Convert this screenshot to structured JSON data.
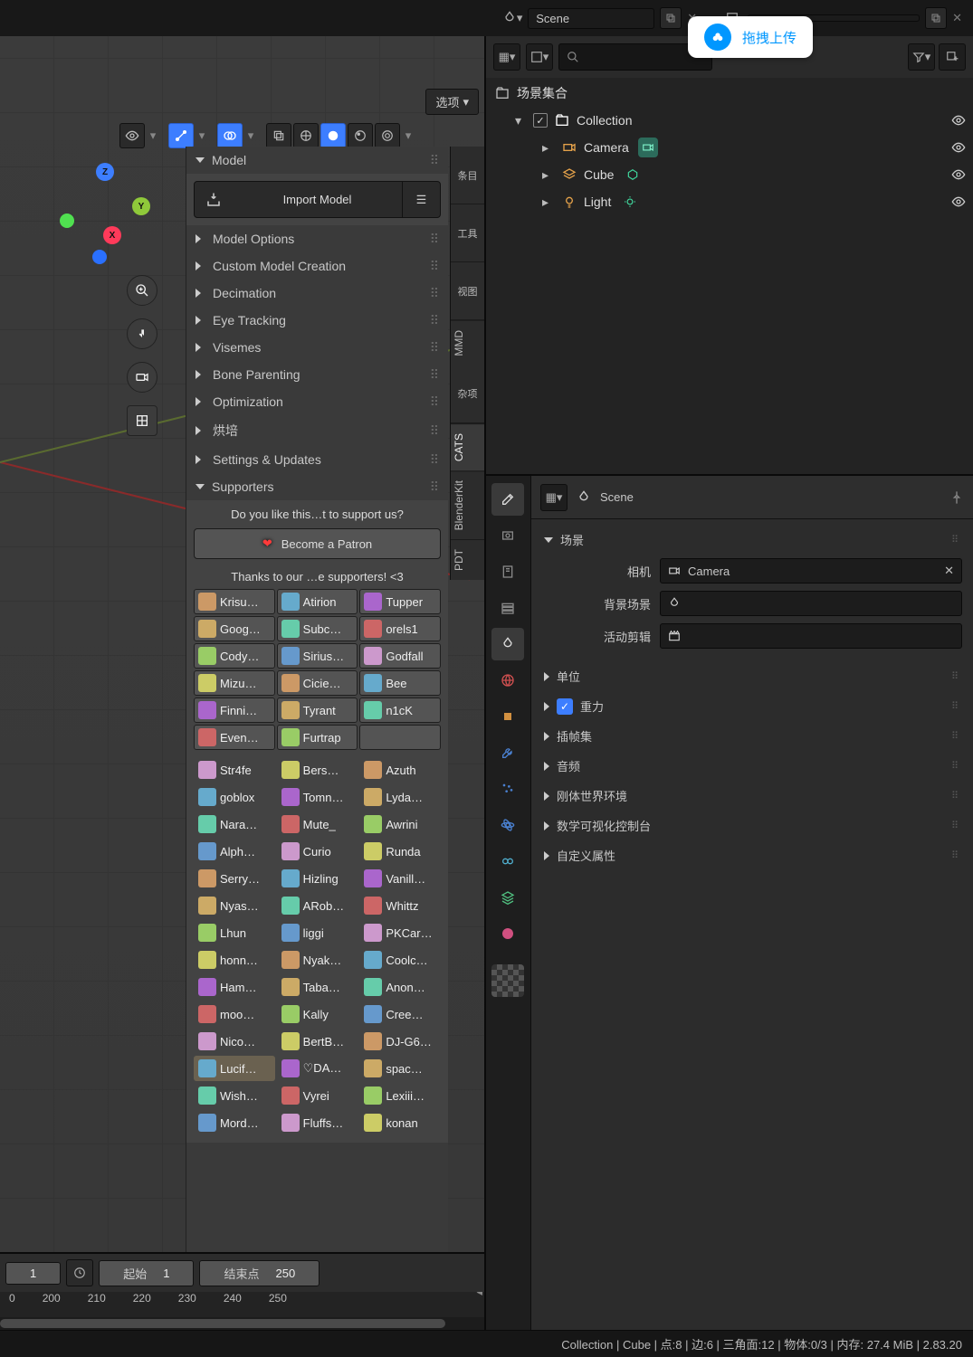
{
  "header": {
    "scene1": "Scene",
    "scene2": ""
  },
  "upload_badge": "拖拽上传",
  "viewport": {
    "options_btn": "选项"
  },
  "npanel": {
    "sections": {
      "model": "Model",
      "import_model": "Import Model",
      "model_options": "Model Options",
      "custom_creation": "Custom Model Creation",
      "decimation": "Decimation",
      "eye_tracking": "Eye Tracking",
      "visemes": "Visemes",
      "bone_parenting": "Bone Parenting",
      "optimization": "Optimization",
      "baking": "烘培",
      "settings": "Settings & Updates",
      "supporters": "Supporters"
    },
    "vtabs": [
      "条目",
      "工具",
      "视图",
      "MMD",
      "杂项",
      "CATS",
      "BlenderKit",
      "PDT"
    ]
  },
  "supporters": {
    "question": "Do you like this…t to support us?",
    "patron_btn": "Become a Patron",
    "thanks": "Thanks to our …e supporters! <3",
    "top": [
      [
        "Krisu…",
        "Atirion",
        "Tupper"
      ],
      [
        "Goog…",
        "Subc…",
        "orels1"
      ],
      [
        "Cody…",
        "Sirius…",
        "Godfall"
      ],
      [
        "Mizu…",
        "Cicie…",
        "Bee"
      ],
      [
        "Finni…",
        "Tyrant",
        "n1cK"
      ],
      [
        "Even…",
        "Furtrap",
        ""
      ]
    ],
    "rest": [
      [
        "Str4fe",
        "Bers…",
        "Azuth"
      ],
      [
        "goblox",
        "Tomn…",
        "Lyda…"
      ],
      [
        "Nara…",
        "Mute_",
        "Awrini"
      ],
      [
        "Alph…",
        "Curio",
        "Runda"
      ],
      [
        "Serry…",
        "Hizling",
        "Vanill…"
      ],
      [
        "Nyas…",
        "ARob…",
        "Whittz"
      ],
      [
        "Lhun",
        "liggi",
        "PKCar…"
      ],
      [
        "honn…",
        "Nyak…",
        "Coolc…"
      ],
      [
        "Ham…",
        "Taba…",
        "Anon…"
      ],
      [
        "moo…",
        "Kally",
        "Cree…"
      ],
      [
        "Nico…",
        "BertB…",
        "DJ-G6…"
      ],
      [
        "Lucif…",
        "♡DA…",
        "spac…"
      ],
      [
        "Wish…",
        "Vyrei",
        "Lexiii…"
      ],
      [
        "Mord…",
        "Fluffs…",
        "konan"
      ]
    ]
  },
  "timeline": {
    "frame": "1",
    "start_lbl": "起始",
    "start_val": "1",
    "end_lbl": "结束点",
    "end_val": "250",
    "ticks": [
      "0",
      "200",
      "210",
      "220",
      "230",
      "240",
      "250"
    ]
  },
  "outliner": {
    "scene_collection": "场景集合",
    "collection": "Collection",
    "objects": [
      {
        "name": "Camera",
        "type": "camera"
      },
      {
        "name": "Cube",
        "type": "mesh"
      },
      {
        "name": "Light",
        "type": "light"
      }
    ]
  },
  "props": {
    "scene_label": "Scene",
    "scene_panel_title": "场景",
    "fields": {
      "camera_lbl": "相机",
      "camera_val": "Camera",
      "bgscene_lbl": "背景场景",
      "clip_lbl": "活动剪辑"
    },
    "sections": [
      "单位",
      "重力",
      "插帧集",
      "音频",
      "刚体世界环境",
      "数学可视化控制台",
      "自定义属性"
    ]
  },
  "status": {
    "text": "Collection | Cube | 点:8 | 边:6 | 三角面:12 | 物体:0/3  | 内存: 27.4 MiB | 2.83.20"
  }
}
